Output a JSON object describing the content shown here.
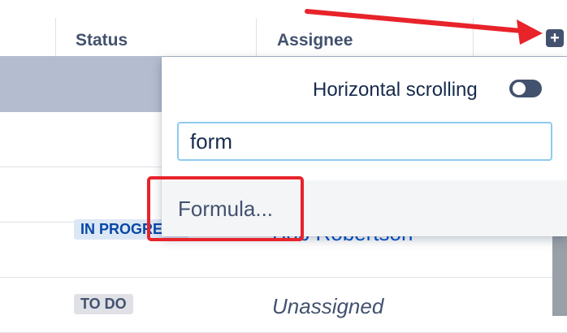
{
  "table": {
    "columns": [
      {
        "label": "Status"
      },
      {
        "label": "Assignee"
      }
    ],
    "rows": [
      {
        "status": "IN PROGRESS",
        "assignee": "Bob Robertson"
      },
      {
        "status": "TO DO",
        "assignee": "Unassigned"
      }
    ]
  },
  "popup": {
    "toggle_label": "Horizontal scrolling",
    "toggle_on": false,
    "search_value": "form",
    "options": [
      {
        "label": "Formula..."
      }
    ]
  },
  "colors": {
    "annotation": "#e8232a",
    "header_text": "#42526e",
    "assignee_link": "#0052cc",
    "input_focus": "#8ecbf0"
  },
  "icons": {
    "add_column": "plus-icon"
  }
}
